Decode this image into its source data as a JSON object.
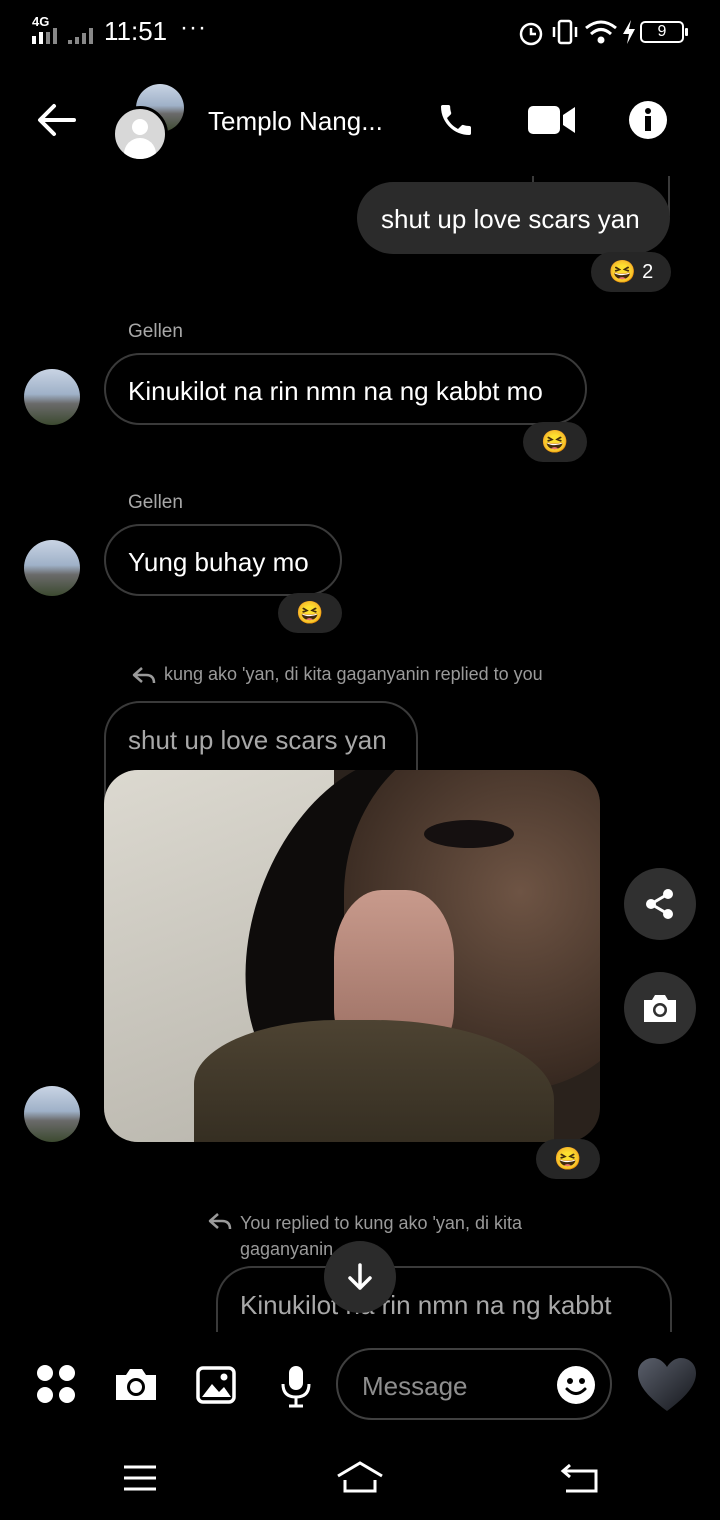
{
  "status": {
    "network": "4G",
    "time": "11:51",
    "more": "···",
    "battery": "9"
  },
  "header": {
    "title": "Templo Nang..."
  },
  "messages": {
    "m1": {
      "text": "shut up love scars yan",
      "reaction_emoji": "😆",
      "reaction_count": "2"
    },
    "m2": {
      "sender": "Gellen",
      "text": "Kinukilot na rin nmn na ng kabbt mo",
      "reaction_emoji": "😆"
    },
    "m3": {
      "sender": "Gellen",
      "text": "Yung buhay mo",
      "reaction_emoji": "😆"
    },
    "m4": {
      "reply_note": "kung ako 'yan, di kita gaganyanin replied to you",
      "quoted": "shut up love scars yan",
      "reaction_emoji": "😆"
    },
    "m5": {
      "reply_note": "You replied to kung ako 'yan, di kita gaganyanin",
      "quoted": "Kinukilot na rin nmn na ng kabbt"
    }
  },
  "composer": {
    "placeholder": "Message"
  },
  "colors": {
    "background": "#000000",
    "bubble_outgoing": "#2b2b2b",
    "bubble_border": "#3a3a3a",
    "muted_text": "#a8a8a8"
  }
}
